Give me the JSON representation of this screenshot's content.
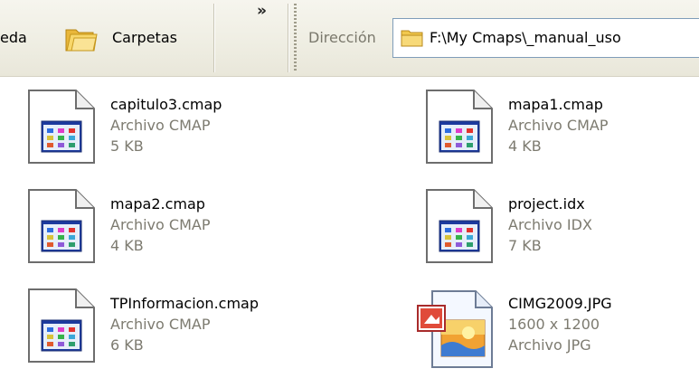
{
  "toolbar": {
    "search_partial_label": "eda",
    "folders_label": "Carpetas",
    "more_chevron": "»",
    "address_label": "Dirección",
    "address_value": "F:\\My Cmaps\\_manual_uso"
  },
  "files": [
    {
      "name": "capitulo3.cmap",
      "line2": "Archivo CMAP",
      "line3": "5 KB",
      "icon": "cmap-document-icon"
    },
    {
      "name": "mapa1.cmap",
      "line2": "Archivo CMAP",
      "line3": "4 KB",
      "icon": "cmap-document-icon"
    },
    {
      "name": "mapa2.cmap",
      "line2": "Archivo CMAP",
      "line3": "4 KB",
      "icon": "cmap-document-icon"
    },
    {
      "name": "project.idx",
      "line2": "Archivo IDX",
      "line3": "7 KB",
      "icon": "cmap-document-icon"
    },
    {
      "name": "TPInformacion.cmap",
      "line2": "Archivo CMAP",
      "line3": "6 KB",
      "icon": "cmap-document-icon"
    },
    {
      "name": "CIMG2009.JPG",
      "line2": "1600 x 1200",
      "line3": "Archivo JPG",
      "icon": "jpg-image-icon"
    }
  ],
  "colors": {
    "toolbar_bg": "#efeee3",
    "secondary_text": "#7d7b70",
    "address_border": "#7f9db9",
    "folder_yellow": "#f5cf5a"
  }
}
